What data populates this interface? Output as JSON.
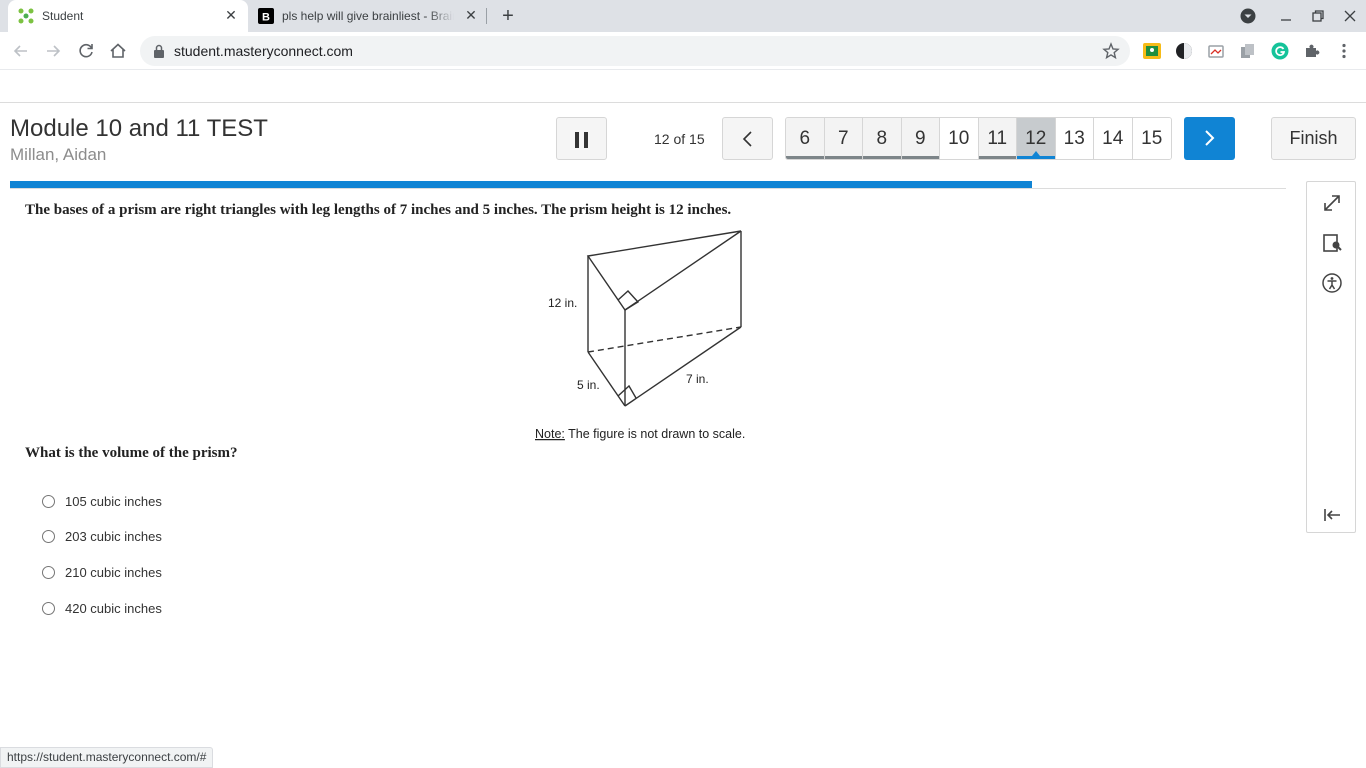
{
  "browser": {
    "tabs": [
      {
        "title": "Student",
        "active": true,
        "icon": "masteryconnect-icon"
      },
      {
        "title": "pls help will give brainliest - Brainly",
        "active": false,
        "icon": "brainly-icon"
      }
    ],
    "url": "student.masteryconnect.com",
    "status_url": "https://student.masteryconnect.com/#"
  },
  "header": {
    "title": "Module 10 and 11 TEST",
    "student": "Millan, Aidan",
    "position": "12 of 15",
    "question_numbers": [
      "6",
      "7",
      "8",
      "9",
      "10",
      "11",
      "12",
      "13",
      "14",
      "15"
    ],
    "answered": [
      "6",
      "7",
      "8",
      "9",
      "11"
    ],
    "current": "12",
    "finish_label": "Finish"
  },
  "progress": {
    "fraction": 0.8
  },
  "question": {
    "stem": "The bases of a prism are right triangles with leg lengths of 7 inches and 5 inches. The prism height is 12 inches.",
    "figure": {
      "height_label": "12 in.",
      "leg_a_label": "5 in.",
      "leg_b_label": "7 in.",
      "note_label": "Note:",
      "note_text": " The figure is not drawn to scale."
    },
    "prompt": "What is the volume of the prism?",
    "choices": [
      "105 cubic inches",
      "203 cubic inches",
      "210 cubic inches",
      "420 cubic inches"
    ]
  },
  "tools": [
    "expand-icon",
    "line-reader-icon",
    "accessibility-icon",
    "collapse-panel-icon"
  ],
  "colors": {
    "accent": "#1084d4",
    "answered_marker": "#7d8589"
  }
}
